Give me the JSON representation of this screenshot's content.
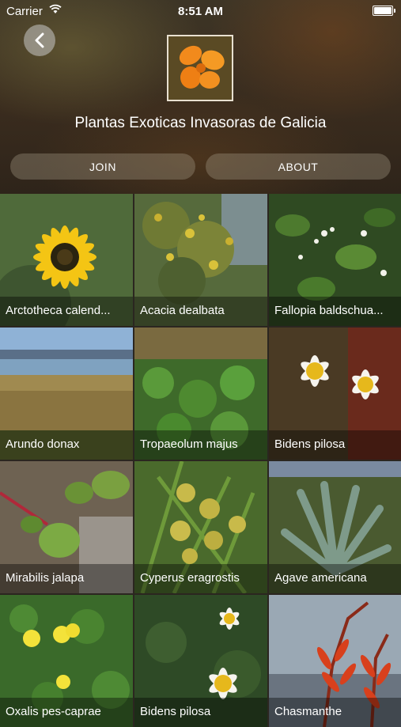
{
  "status_bar": {
    "carrier": "Carrier",
    "time": "8:51 AM"
  },
  "header": {
    "title": "Plantas Exoticas Invasoras de Galicia",
    "join_label": "JOIN",
    "about_label": "ABOUT"
  },
  "species": [
    {
      "name": "Arctotheca calend...",
      "icon": "yellow-daisy-photo"
    },
    {
      "name": "Acacia dealbata",
      "icon": "acacia-photo"
    },
    {
      "name": "Fallopia baldschua...",
      "icon": "fallopia-photo"
    },
    {
      "name": "Arundo donax",
      "icon": "reeds-photo"
    },
    {
      "name": "Tropaeolum majus",
      "icon": "nasturtium-photo"
    },
    {
      "name": "Bidens pilosa",
      "icon": "white-daisy-photo"
    },
    {
      "name": "Mirabilis jalapa",
      "icon": "mirabilis-photo"
    },
    {
      "name": "Cyperus eragrostis",
      "icon": "sedge-photo"
    },
    {
      "name": "Agave americana",
      "icon": "agave-photo"
    },
    {
      "name": "Oxalis pes-caprae",
      "icon": "oxalis-photo"
    },
    {
      "name": "Bidens pilosa",
      "icon": "white-daisy-photo"
    },
    {
      "name": "Chasmanthe",
      "icon": "red-flower-photo"
    }
  ]
}
